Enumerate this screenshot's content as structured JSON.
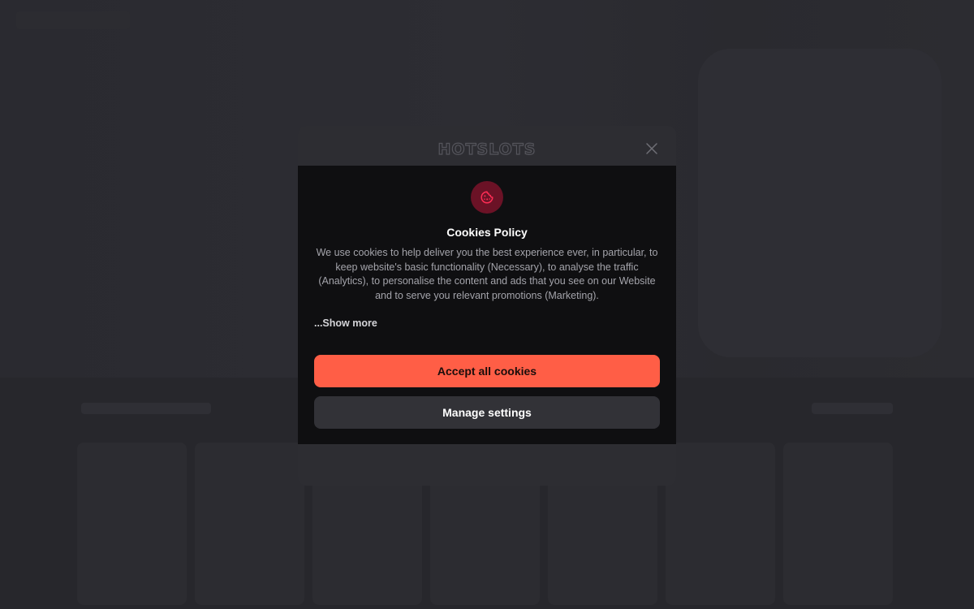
{
  "modal": {
    "logo_text": "HOTSLOTS",
    "close_icon": "close-icon",
    "cookie_icon": "cookie-icon",
    "title": "Cookies Policy",
    "body": "We use cookies to help deliver you the best experience ever, in particular, to keep website's basic functionality (Necessary), to analyse the traffic (Analytics), to personalise the content and ads that you see on our Website and to serve you relevant promotions (Marketing).",
    "show_more_label": "...Show more",
    "accept_label": "Accept all cookies",
    "manage_label": "Manage settings"
  },
  "colors": {
    "accent": "#ff5e46",
    "cookie_icon_bg": "#6b1226",
    "cookie_icon_fg": "#ff2d55",
    "panel_bg": "#0f0f11",
    "modal_bg": "#2d2d32",
    "secondary_button_bg": "#323237"
  }
}
